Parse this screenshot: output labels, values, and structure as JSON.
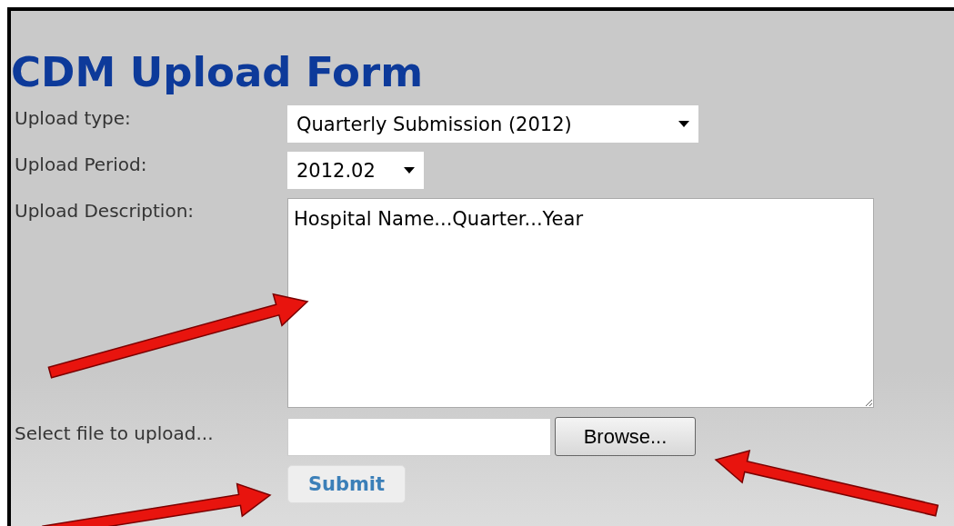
{
  "title": "CDM Upload Form",
  "fields": [
    {
      "label": "Upload type:",
      "kind": "select",
      "value": "Quarterly Submission (2012)"
    },
    {
      "label": "Upload Period:",
      "kind": "select",
      "value": "2012.02"
    },
    {
      "label": "Upload Description:",
      "kind": "textarea",
      "value": "Hospital Name...Quarter...Year"
    },
    {
      "label": "Select file to upload...",
      "kind": "file",
      "button": "Browse..."
    }
  ],
  "submit": "Submit",
  "annotations": [
    {
      "kind": "arrow"
    },
    {
      "kind": "arrow"
    },
    {
      "kind": "arrow"
    }
  ]
}
